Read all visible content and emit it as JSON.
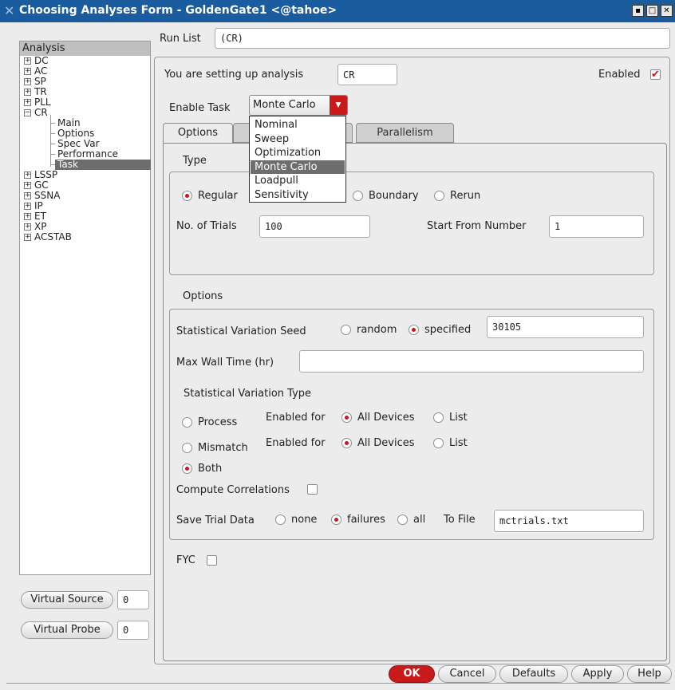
{
  "window": {
    "title": "Choosing Analyses Form - GoldenGate1 <@tahoe>"
  },
  "run_list": {
    "label": "Run List",
    "value": "(CR)"
  },
  "tree": {
    "header": "Analysis",
    "items": [
      {
        "label": "DC",
        "expander": "+"
      },
      {
        "label": "AC",
        "expander": "+"
      },
      {
        "label": "SP",
        "expander": "+"
      },
      {
        "label": "TR",
        "expander": "+"
      },
      {
        "label": "PLL",
        "expander": "+"
      },
      {
        "label": "CR",
        "expander": "−"
      },
      {
        "label": "Main"
      },
      {
        "label": "Options"
      },
      {
        "label": "Spec Var"
      },
      {
        "label": "Performance"
      },
      {
        "label": "Task"
      },
      {
        "label": "LSSP",
        "expander": "+"
      },
      {
        "label": "GC",
        "expander": "+"
      },
      {
        "label": "SSNA",
        "expander": "+"
      },
      {
        "label": "IP",
        "expander": "+"
      },
      {
        "label": "ET",
        "expander": "+"
      },
      {
        "label": "XP",
        "expander": "+"
      },
      {
        "label": "ACSTAB",
        "expander": "+"
      }
    ]
  },
  "virtual": {
    "source_label": "Virtual Source",
    "source_count": "0",
    "probe_label": "Virtual Probe",
    "probe_count": "0"
  },
  "setup": {
    "label": "You are setting up analysis",
    "analysis": "CR",
    "enabled_label": "Enabled"
  },
  "task": {
    "label": "Enable Task",
    "selected": "Monte Carlo",
    "options": [
      "Nominal",
      "Sweep",
      "Optimization",
      "Monte Carlo",
      "Loadpull",
      "Sensitivity"
    ]
  },
  "tabs": [
    "Options",
    "Parallelism"
  ],
  "type_section": {
    "title": "Type",
    "regular": "Regular",
    "boundary": "Boundary",
    "rerun": "Rerun",
    "trials_label": "No. of Trials",
    "trials_value": "100",
    "start_label": "Start From Number",
    "start_value": "1"
  },
  "options_section": {
    "title": "Options",
    "seed_label": "Statistical Variation Seed",
    "random": "random",
    "specified": "specified",
    "seed_value": "30105",
    "wall_label": "Max Wall Time (hr)",
    "wall_value": "",
    "svt_label": "Statistical Variation Type",
    "process": "Process",
    "mismatch": "Mismatch",
    "both": "Both",
    "enabled_for": "Enabled for",
    "all_devices": "All Devices",
    "list": "List",
    "correlations": "Compute Correlations",
    "save_label": "Save Trial Data",
    "none": "none",
    "failures": "failures",
    "all": "all",
    "to_file": "To File",
    "file_value": "mctrials.txt"
  },
  "fyc": "FYC",
  "buttons": {
    "ok": "OK",
    "cancel": "Cancel",
    "defaults": "Defaults",
    "apply": "Apply",
    "help": "Help"
  },
  "colors": {
    "title_bar": "#1b5c9e",
    "accent_red": "#d0141c",
    "selection": "#6d6d6d"
  }
}
